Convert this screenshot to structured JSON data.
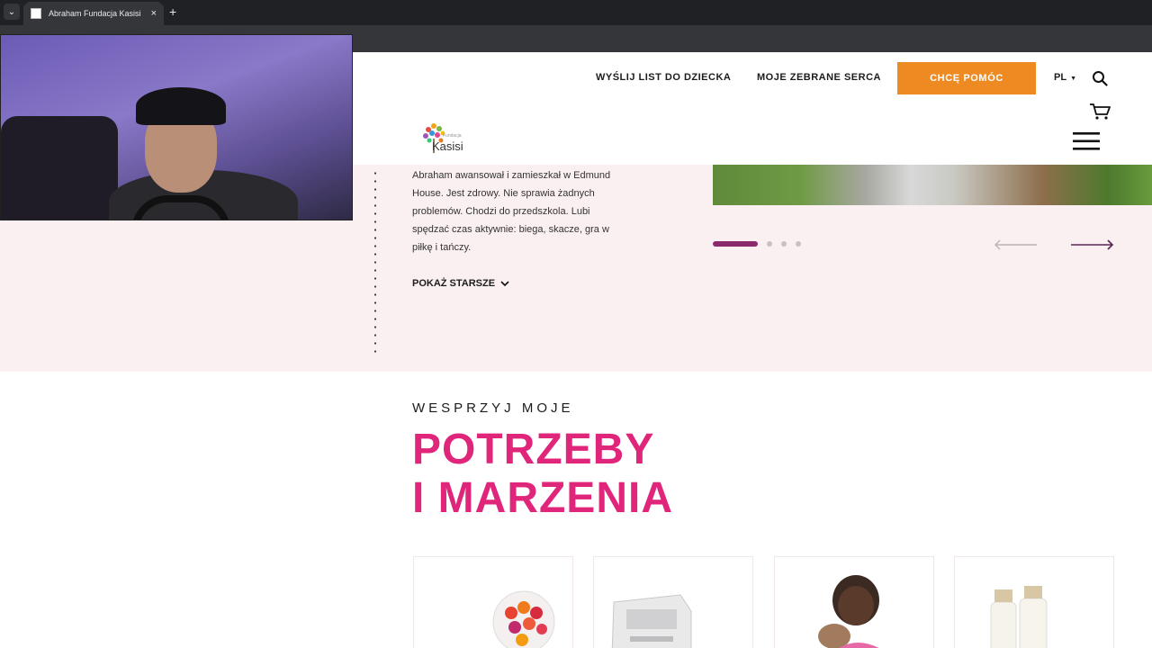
{
  "browser": {
    "tab_title": "Abraham Fundacja Kasisi",
    "tab_close": "×",
    "new_tab": "+",
    "tab_dropdown": "⌄"
  },
  "header": {
    "nav": [
      {
        "label": "WYŚLIJ LIST DO DZIECKA"
      },
      {
        "label": "MOJE ZEBRANE SERCA"
      }
    ],
    "help_button": "CHCĘ POMÓC",
    "language": "PL",
    "logo_text": "Kasisi",
    "logo_small": "Fundacja"
  },
  "story": {
    "text": "Abraham awansował i zamieszkał w Edmund House. Jest zdrowy. Nie sprawia żadnych problemów. Chodzi do przedszkola. Lubi spędzać czas aktywnie: biega, skacze, gra w piłkę i tańczy.",
    "show_older": "POKAŻ STARSZE"
  },
  "slider": {
    "total_slides": 4,
    "active_slide": 1
  },
  "needs_section": {
    "kicker": "WESPRZYJ MOJE",
    "title_line1": "POTRZEBY",
    "title_line2": "I MARZENIA"
  },
  "colors": {
    "accent_orange": "#ed8a22",
    "accent_pink": "#e0267a",
    "slider_active": "#8a2a6d",
    "band_pink": "#fbf0f1"
  },
  "icons": {
    "search": "search-icon",
    "cart": "cart-icon",
    "menu": "hamburger-menu-icon",
    "arrow_left": "arrow-left-icon",
    "arrow_right": "arrow-right-icon"
  }
}
